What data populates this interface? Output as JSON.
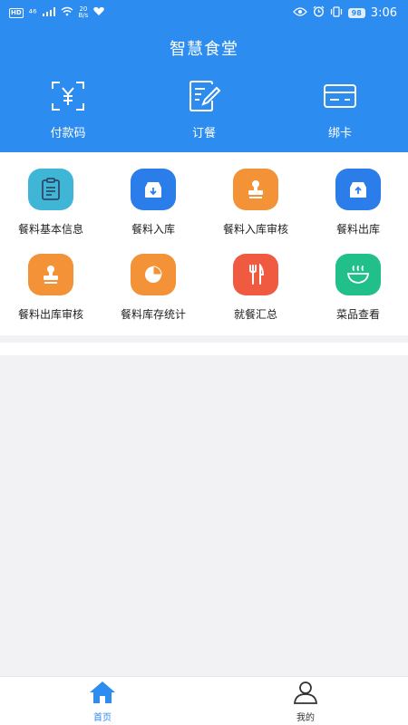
{
  "status_bar": {
    "hd": "HD",
    "signal": "⁴⁶",
    "net_speed_value": "20",
    "net_speed_unit": "B/s",
    "battery": "98",
    "time": "3:06"
  },
  "header": {
    "title": "智慧食堂",
    "background": "#2d8cf0"
  },
  "top_actions": [
    {
      "label": "付款码",
      "icon": "payment-code-icon"
    },
    {
      "label": "订餐",
      "icon": "order-meal-icon"
    },
    {
      "label": "绑卡",
      "icon": "bind-card-icon"
    }
  ],
  "grid": [
    {
      "label": "餐料基本信息",
      "icon": "clipboard-icon",
      "color": "#3fb6d6"
    },
    {
      "label": "餐料入库",
      "icon": "inbox-down-icon",
      "color": "#2b7de9"
    },
    {
      "label": "餐料入库审核",
      "icon": "stamp-icon",
      "color": "#f39236"
    },
    {
      "label": "餐料出库",
      "icon": "inbox-up-icon",
      "color": "#2b7de9"
    },
    {
      "label": "餐料出库审核",
      "icon": "stamp-icon",
      "color": "#f39236"
    },
    {
      "label": "餐料库存统计",
      "icon": "pie-chart-icon",
      "color": "#f39236"
    },
    {
      "label": "就餐汇总",
      "icon": "fork-knife-icon",
      "color": "#ef5a41"
    },
    {
      "label": "菜品查看",
      "icon": "bowl-icon",
      "color": "#21c08b"
    }
  ],
  "tabbar": {
    "home_label": "首页",
    "mine_label": "我的",
    "active_color": "#2d8cf0",
    "inactive_color": "#333333"
  }
}
